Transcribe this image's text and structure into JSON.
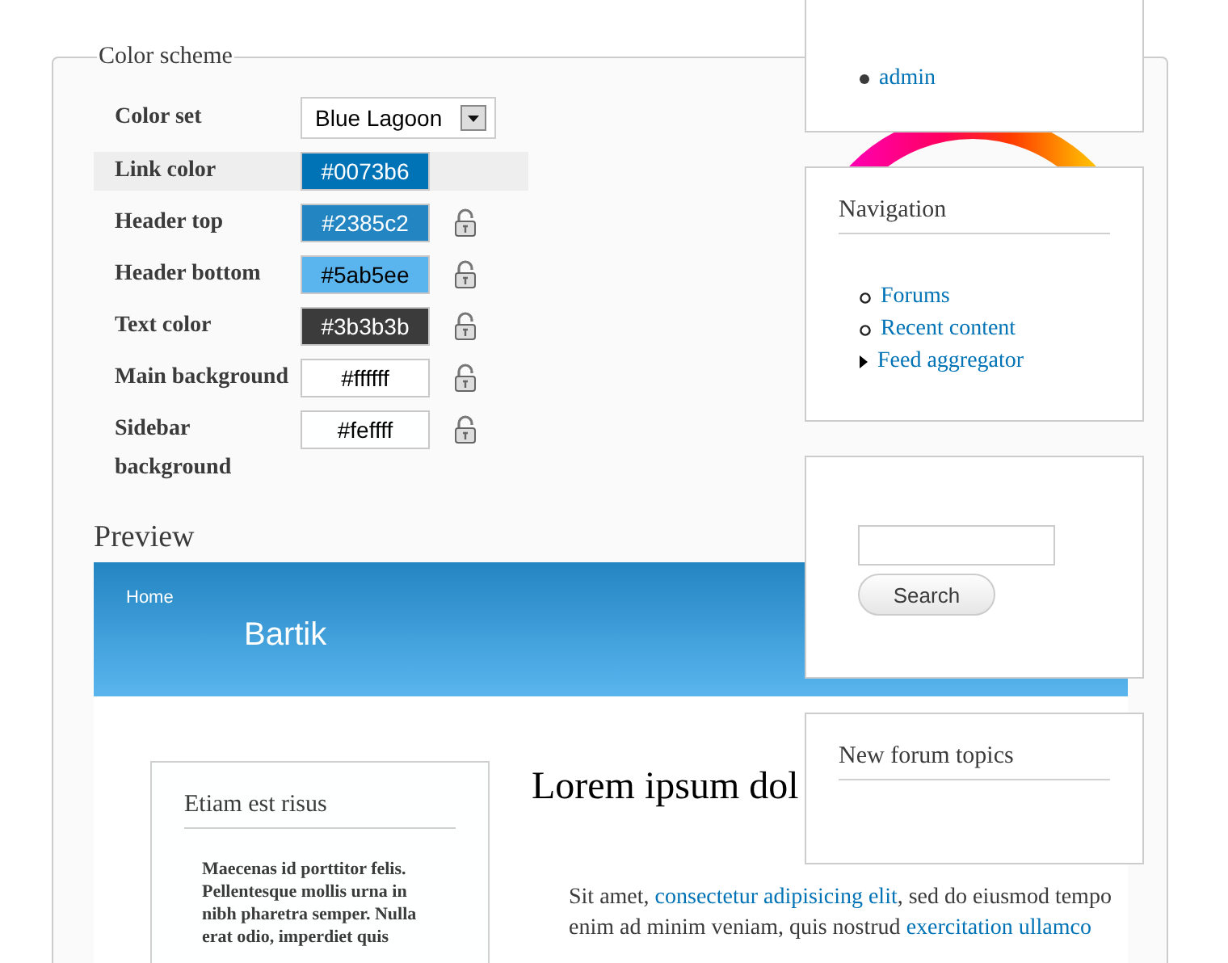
{
  "color_scheme": {
    "legend": "Color scheme",
    "color_set": {
      "label": "Color set",
      "value": "Blue Lagoon"
    },
    "fields": [
      {
        "label": "Link color",
        "value": "#0073b6",
        "color": "#0073b6",
        "selected": true,
        "lock": false
      },
      {
        "label": "Header top",
        "value": "#2385c2",
        "color": "#2385c2",
        "selected": false,
        "lock": true
      },
      {
        "label": "Header bottom",
        "value": "#5ab5ee",
        "color": "#5ab5ee",
        "selected": false,
        "lock": true
      },
      {
        "label": "Text color",
        "value": "#3b3b3b",
        "color": "#3b3b3b",
        "selected": false,
        "lock": true
      },
      {
        "label": "Main background",
        "value": "#ffffff",
        "color": "#ffffff",
        "selected": false,
        "lock": true
      },
      {
        "label": "Sidebar background",
        "value": "#feffff",
        "color": "#feffff",
        "selected": false,
        "lock": true
      }
    ]
  },
  "preview": {
    "title": "Preview",
    "home_link": "Home",
    "site_name": "Bartik",
    "sidebar_block": {
      "title": "Etiam est risus",
      "lines": [
        "Maecenas id porttitor felis.",
        "Pellentesque mollis urna in",
        "nibh pharetra semper. Nulla",
        "erat odio, imperdiet quis"
      ]
    },
    "page_title": "Lorem ipsum dol",
    "body_lines": [
      [
        {
          "text": "Sit amet, ",
          "link": false
        },
        {
          "text": "consectetur adipisicing elit",
          "link": true
        },
        {
          "text": ", sed do eiusmod tempo",
          "link": false
        }
      ],
      [
        {
          "text": "enim ad minim veniam, quis nostrud ",
          "link": false
        },
        {
          "text": "exercitation ullamco",
          "link": true
        }
      ]
    ]
  },
  "blocks": [
    {
      "kind": "list",
      "items": [
        {
          "label": "admin",
          "kind": "disc"
        }
      ]
    },
    {
      "kind": "list",
      "title": "Navigation",
      "items": [
        {
          "label": "Forums",
          "kind": "leaf"
        },
        {
          "label": "Recent content",
          "kind": "leaf"
        },
        {
          "label": "Feed aggregator",
          "kind": "collapsed"
        }
      ]
    },
    {
      "kind": "search",
      "button": "Search"
    },
    {
      "kind": "list",
      "title": "New forum topics"
    }
  ]
}
